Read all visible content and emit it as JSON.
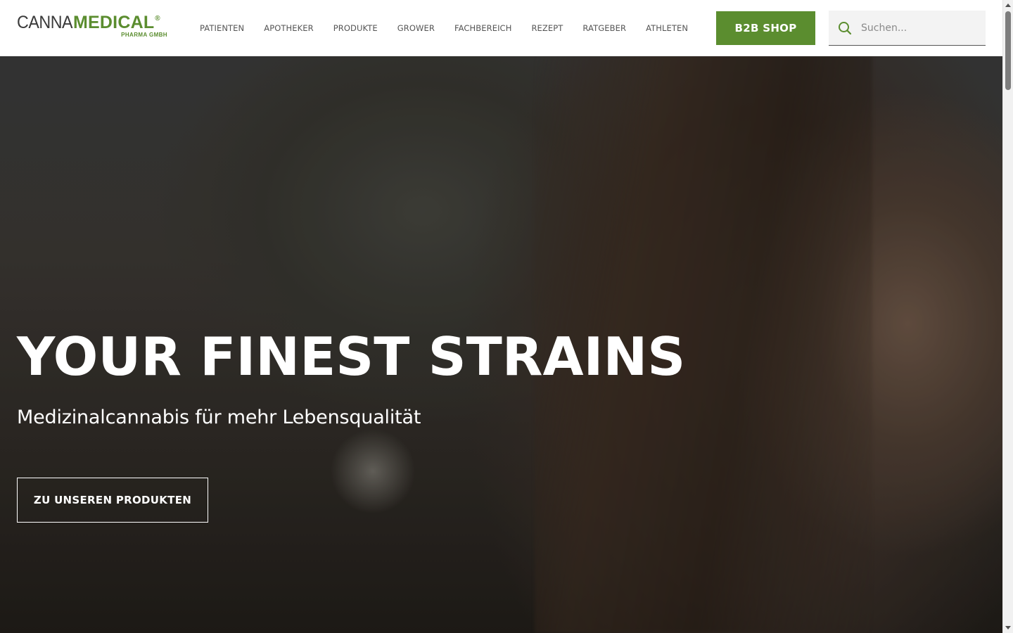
{
  "header": {
    "logo": {
      "canna": "CANNA",
      "medical": "MEDICAL",
      "registered": "®",
      "sub": "PHARMA GMBH"
    },
    "nav": [
      {
        "label": "PATIENTEN"
      },
      {
        "label": "APOTHEKER"
      },
      {
        "label": "PRODUKTE"
      },
      {
        "label": "GROWER"
      },
      {
        "label": "FACHBEREICH"
      },
      {
        "label": "REZEPT"
      },
      {
        "label": "RATGEBER"
      },
      {
        "label": "ATHLETEN"
      }
    ],
    "b2b_label": "B2B SHOP",
    "search": {
      "placeholder": "Suchen...",
      "icon": "search-icon"
    }
  },
  "hero": {
    "title": "YOUR FINEST STRAINS",
    "subtitle": "Medizinalcannabis für mehr Lebensqualität",
    "cta_label": "ZU UNSEREN PRODUKTEN"
  },
  "colors": {
    "brand_green": "#5b8d2f",
    "text_dark": "#3a3a3a",
    "white": "#ffffff"
  }
}
